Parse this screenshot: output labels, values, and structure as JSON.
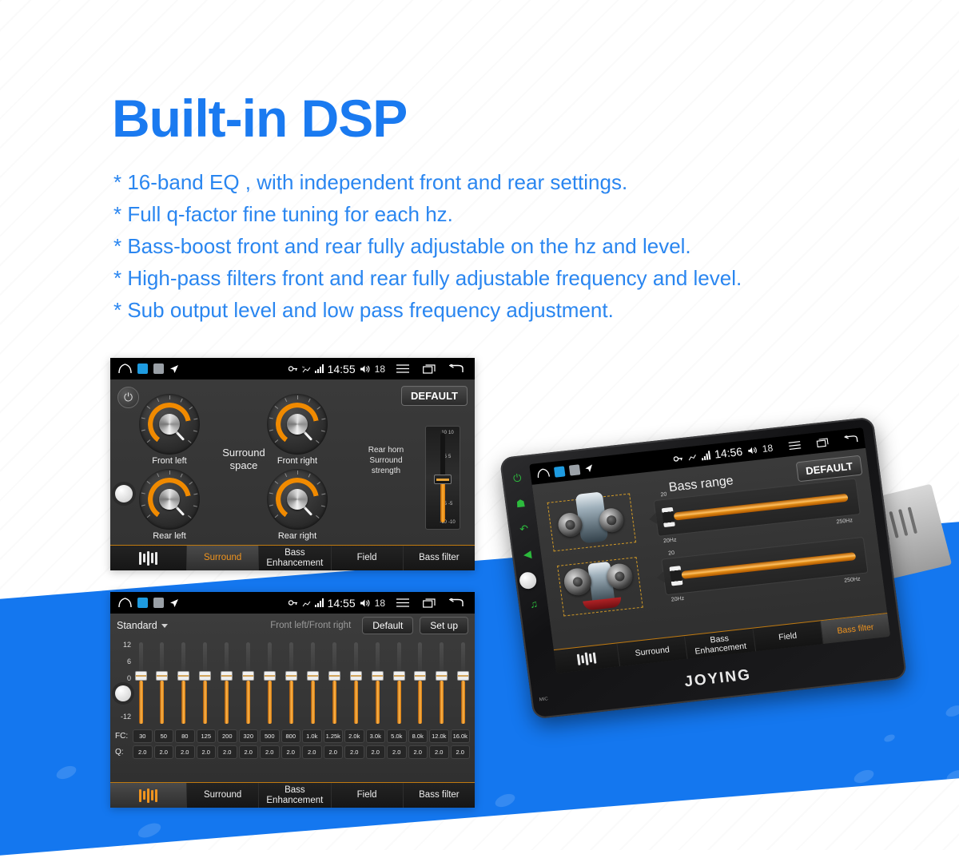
{
  "headline": "Built-in DSP",
  "features": [
    "* 16-band EQ , with independent front and rear settings.",
    "* Full q-factor fine tuning for each hz.",
    "* Bass-boost front and rear fully adjustable on the hz and level.",
    "* High-pass filters front and rear fully adjustable frequency and level.",
    "* Sub output level and  low pass frequency adjustment."
  ],
  "colors": {
    "brand_blue": "#1a7af0",
    "accent_orange": "#f0941e",
    "panel_dark": "#333333"
  },
  "statusbar": {
    "time_surround": "14:55",
    "time_device": "14:56",
    "volume": "18",
    "icons": [
      "home-icon",
      "app-icon-blue",
      "app-icon-grey",
      "navigation-icon",
      "key-icon",
      "gps-icon",
      "signal-icon",
      "volume-icon",
      "menu-icon",
      "recents-icon",
      "back-icon"
    ]
  },
  "screen_surround": {
    "default_button": "DEFAULT",
    "power_icon": "power-icon",
    "knobs": [
      {
        "label": "Front left",
        "value": 78
      },
      {
        "label": "Front right",
        "value": 78
      },
      {
        "label": "Rear left",
        "value": 78
      },
      {
        "label": "Rear right",
        "value": 78
      }
    ],
    "knob_scale": [
      "0",
      "10",
      "20",
      "30",
      "40",
      "50",
      "60",
      "70",
      "80",
      "90",
      "100"
    ],
    "center_label": "Surround\nspace",
    "center_label_line1": "Surround",
    "center_label_line2": "space",
    "fader": {
      "title_line1": "Rear horn",
      "title_line2": "Surround",
      "title_line3": "strength",
      "scale": [
        "10",
        "5",
        "0",
        "-5",
        "-10"
      ],
      "value": "-2"
    },
    "tabs": [
      {
        "label": "",
        "icon": "equalizer-icon",
        "active": false
      },
      {
        "label": "Surround",
        "active": true
      },
      {
        "label": "Bass\nEnhancement",
        "line1": "Bass",
        "line2": "Enhancement",
        "active": false
      },
      {
        "label": "Field",
        "active": false
      },
      {
        "label": "Bass filter",
        "active": false
      }
    ]
  },
  "screen_eq": {
    "preset": "Standard",
    "channel": "Front left/Front right",
    "default_button": "Default",
    "setup_button": "Set up",
    "y_axis": [
      "12",
      "6",
      "0",
      "-12"
    ],
    "row_labels": {
      "fc": "FC:",
      "q": "Q:"
    },
    "bands": [
      {
        "fc": "30",
        "q": "2.0",
        "gain": 0
      },
      {
        "fc": "50",
        "q": "2.0",
        "gain": 0
      },
      {
        "fc": "80",
        "q": "2.0",
        "gain": 0
      },
      {
        "fc": "125",
        "q": "2.0",
        "gain": 0
      },
      {
        "fc": "200",
        "q": "2.0",
        "gain": 0
      },
      {
        "fc": "320",
        "q": "2.0",
        "gain": 0
      },
      {
        "fc": "500",
        "q": "2.0",
        "gain": 0
      },
      {
        "fc": "800",
        "q": "2.0",
        "gain": 0
      },
      {
        "fc": "1.0k",
        "q": "2.0",
        "gain": 0
      },
      {
        "fc": "1.25k",
        "q": "2.0",
        "gain": 0
      },
      {
        "fc": "2.0k",
        "q": "2.0",
        "gain": 0
      },
      {
        "fc": "3.0k",
        "q": "2.0",
        "gain": 0
      },
      {
        "fc": "5.0k",
        "q": "2.0",
        "gain": 0
      },
      {
        "fc": "8.0k",
        "q": "2.0",
        "gain": 0
      },
      {
        "fc": "12.0k",
        "q": "2.0",
        "gain": 0
      },
      {
        "fc": "16.0k",
        "q": "2.0",
        "gain": 0
      }
    ],
    "tabs": [
      {
        "label": "",
        "icon": "equalizer-icon",
        "active": true
      },
      {
        "label": "Surround",
        "active": false
      },
      {
        "line1": "Bass",
        "line2": "Enhancement",
        "active": false
      },
      {
        "label": "Field",
        "active": false
      },
      {
        "label": "Bass filter",
        "active": false
      }
    ]
  },
  "device": {
    "brand": "JOYING",
    "mic_label": "MIC",
    "default_button": "DEFAULT",
    "title": "Bass range",
    "sliders": [
      {
        "current": "20",
        "min": "20Hz",
        "max": "250Hz"
      },
      {
        "current": "20",
        "min": "20Hz",
        "max": "250Hz"
      }
    ],
    "side_buttons": [
      "power-icon",
      "home-icon",
      "back-icon",
      "navigation-icon",
      "volume-up-icon",
      "volume-down-icon"
    ],
    "tabs": [
      {
        "label": "",
        "icon": "equalizer-icon",
        "active": false
      },
      {
        "label": "Surround",
        "active": false
      },
      {
        "line1": "Bass",
        "line2": "Enhancement",
        "active": false
      },
      {
        "label": "Field",
        "active": false
      },
      {
        "label": "Bass filter",
        "active": true
      }
    ]
  }
}
